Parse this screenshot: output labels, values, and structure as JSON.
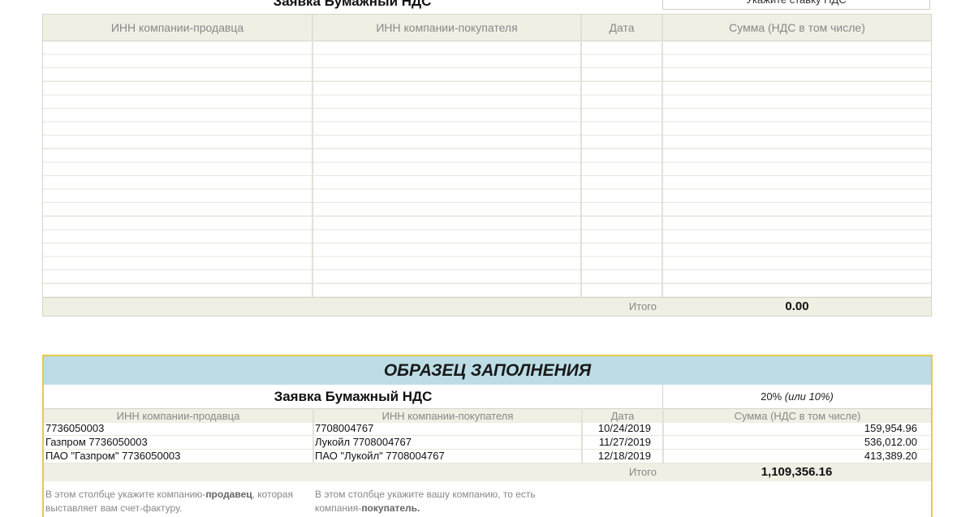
{
  "top_sheet": {
    "clipped_title": "Заявка Бумажный НДС",
    "clipped_rate_hint": "Укажите ставку НДС",
    "headers": [
      "ИНН компании-продавца",
      "ИНН компании-покупателя",
      "Дата",
      "Сумма (НДС в том числе)"
    ],
    "total_label": "Итого",
    "total_value": "0.00"
  },
  "sample_sheet": {
    "banner": "ОБРАЗЕЦ ЗАПОЛНЕНИЯ",
    "title": "Заявка Бумажный НДС",
    "rate_main": "20%",
    "rate_alt": "(или 10%)",
    "headers": [
      "ИНН компании-продавца",
      "ИНН компании-покупателя",
      "Дата",
      "Сумма (НДС в том числе)"
    ],
    "rows": [
      {
        "seller": "7736050003",
        "buyer": "7708004767",
        "date": "10/24/2019",
        "amount": "159,954.96"
      },
      {
        "seller": "Газпром 7736050003",
        "buyer": "Лукойл 7708004767",
        "date": "11/27/2019",
        "amount": "536,012.00"
      },
      {
        "seller": "ПАО \"Газпром\" 7736050003",
        "buyer": "ПАО \"Лукойл\" 7708004767",
        "date": "12/18/2019",
        "amount": "413,389.20"
      }
    ],
    "total_label": "Итого",
    "total_value": "1,109,356.16",
    "note_seller": {
      "pre": "В этом столбце укажите компанию-",
      "bold": "продавец",
      "post": ", которая выставляет вам счет-фактуру."
    },
    "note_buyer": {
      "pre": "В этом столбце укажите вашу компанию, то есть компания-",
      "bold": "покупатель."
    }
  }
}
